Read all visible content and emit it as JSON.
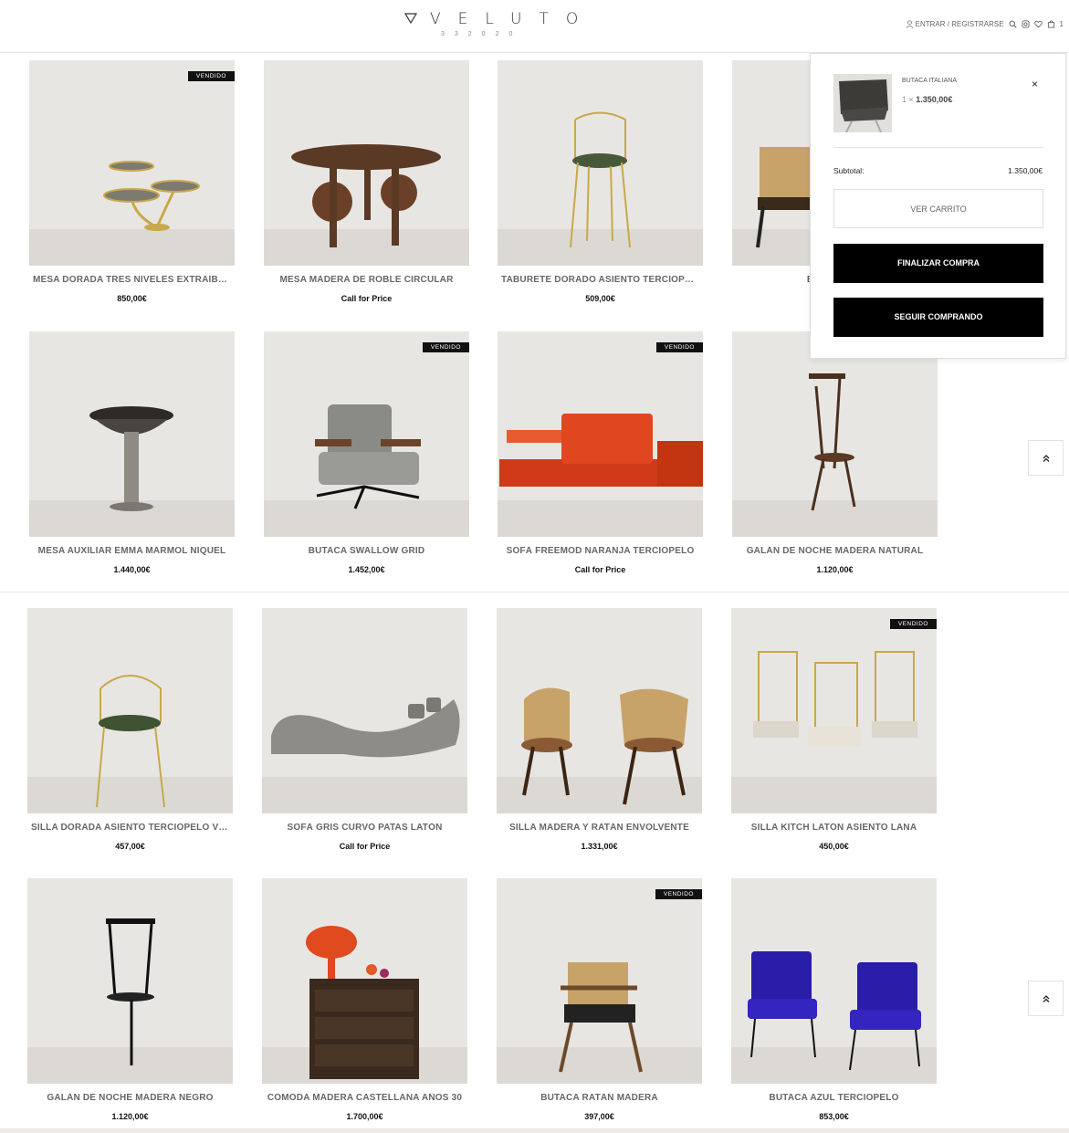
{
  "header": {
    "logo_word": "VELUTO",
    "logo_sub": "332020",
    "login_label": "ENTRAR / REGISTRARSE",
    "cart_count": "1"
  },
  "products": [
    {
      "name": "MESA DORADA TRES NIVELES EXTRAÍBLE...",
      "price": "850,00€",
      "sold": "VENDIDO"
    },
    {
      "name": "MESA MADERA DE ROBLE CIRCULAR",
      "price": "Call for Price"
    },
    {
      "name": "TABURETE DORADO ASIENTO TERCIOPEL...",
      "price": "509,00€"
    },
    {
      "name": "BUTACA MA",
      "price": ""
    },
    {
      "name": "MESA AUXILIAR EMMA MÁRMOL NÍQUEL",
      "price": "1.440,00€"
    },
    {
      "name": "BUTACA SWALLOW GRID",
      "price": "1.452,00€",
      "sold": "VENDIDO"
    },
    {
      "name": "SOFÁ FREEMOD NARANJA TERCIOPELO",
      "price": "Call for Price",
      "sold": "VENDIDO"
    },
    {
      "name": "GALÁN DE NOCHE MADERA NATURAL",
      "price": "1.120,00€"
    },
    {
      "name": "SILLA DORADA ASIENTO TERCIOPELO VERDE",
      "price": "457,00€"
    },
    {
      "name": "SOFÁ GRIS CURVO PATAS LATÓN",
      "price": "Call for Price"
    },
    {
      "name": "SILLA MADERA Y RATÁN ENVOLVENTE",
      "price": "1.331,00€"
    },
    {
      "name": "SILLA KITCH LATÓN ASIENTO LANA",
      "price": "450,00€",
      "sold": "VENDIDO"
    },
    {
      "name": "GALÁN DE NOCHE MADERA NEGRO",
      "price": "1.120,00€"
    },
    {
      "name": "CÓMODA MADERA CASTELLANA AÑOS 30",
      "price": "1.700,00€"
    },
    {
      "name": "BUTACA RATÁN MADERA",
      "price": "397,00€",
      "sold": "VENDIDO"
    },
    {
      "name": "BUTACA AZUL TERCIOPELO",
      "price": "853,00€"
    }
  ],
  "minicart": {
    "item_name": "BUTACA ITALIANA",
    "qty": "1 ×",
    "item_price": "1.350,00€",
    "close": "×",
    "subtotal_label": "Subtotal:",
    "subtotal_value": "1.350,00€",
    "view_cart": "VER CARRITO",
    "checkout": "FINALIZAR COMPRA",
    "continue": "SEGUIR COMPRANDO"
  },
  "scroll_top_icon": "double-chevron-up-icon"
}
